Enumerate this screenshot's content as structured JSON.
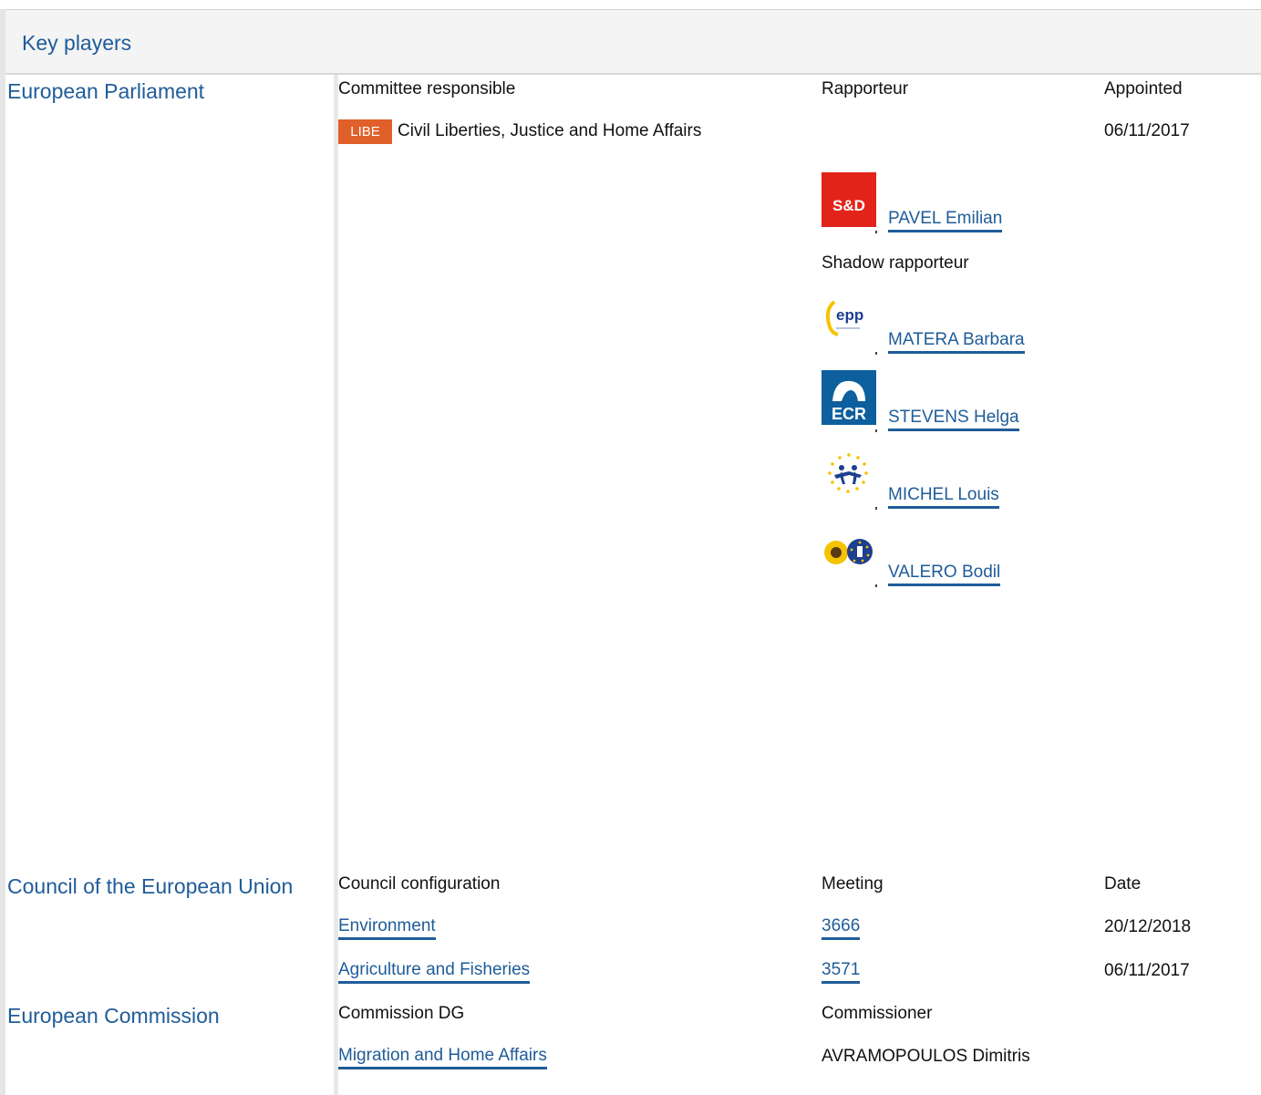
{
  "header": {
    "title": "Key players"
  },
  "european_parliament": {
    "title": "European Parliament",
    "col_committee": "Committee responsible",
    "col_rapporteur": "Rapporteur",
    "col_appointed": "Appointed",
    "committee_badge": "LIBE",
    "committee_name": "Civil Liberties, Justice and Home Affairs",
    "appointed_date": "06/11/2017",
    "rapporteur": {
      "name": "PAVEL Emilian",
      "group_logo": "S&D"
    },
    "shadow_label": "Shadow rapporteur",
    "shadow_rapporteurs": [
      {
        "name": "MATERA Barbara",
        "group_logo": "epp"
      },
      {
        "name": "STEVENS Helga",
        "group_logo": "ECR"
      },
      {
        "name": "MICHEL Louis",
        "group_logo": "alde-stars"
      },
      {
        "name": "VALERO Bodil",
        "group_logo": "greens-efa-sunflower"
      }
    ]
  },
  "council": {
    "title": "Council of the European Union",
    "col_configuration": "Council configuration",
    "col_meeting": "Meeting",
    "col_date": "Date",
    "rows": [
      {
        "configuration": "Environment",
        "meeting": "3666",
        "date": "20/12/2018"
      },
      {
        "configuration": "Agriculture and Fisheries",
        "meeting": "3571",
        "date": "06/11/2017"
      }
    ]
  },
  "commission": {
    "title": "European Commission",
    "col_dg": "Commission DG",
    "col_commissioner": "Commissioner",
    "dg": "Migration and Home Affairs",
    "commissioner": "AVRAMOPOULOS Dimitris"
  },
  "colors": {
    "link": "#1f5c99",
    "badge": "#e0602a",
    "header_bg": "#f4f4f4"
  }
}
